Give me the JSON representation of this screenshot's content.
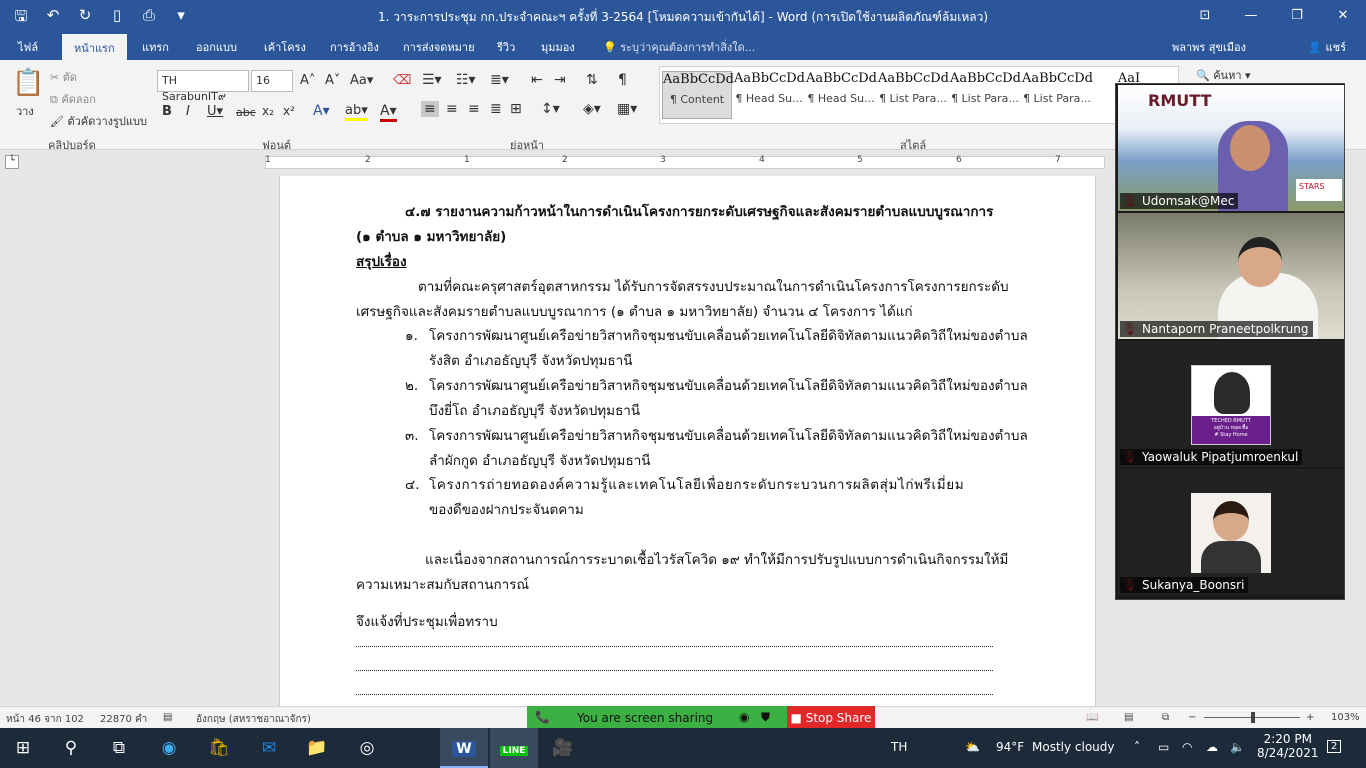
{
  "window": {
    "title": "1. วาระการประชุม กก.ประจำคณะฯ ครั้งที่ 3-2564 [โหมดความเข้ากันได้] - Word (การเปิดใช้งานผลิตภัณฑ์ล้มเหลว)"
  },
  "tabs": [
    "ไฟล์",
    "หน้าแรก",
    "แทรก",
    "ออกแบบ",
    "เค้าโครง",
    "การอ้างอิง",
    "การส่งจดหมาย",
    "รีวิว",
    "มุมมอง"
  ],
  "tell_me": "ระบุว่าคุณต้องการทำสิ่งใด...",
  "user": "พลาพร สุขเมือง",
  "share": "แชร์",
  "ribbon": {
    "paste": "วาง",
    "cut": "ตัด",
    "copy": "คัดลอก",
    "format_painter": "ตัวคัดวางรูปแบบ",
    "clipboard_label": "คลิปบอร์ด",
    "font_name": "TH SarabunIT๙",
    "font_size": "16",
    "font_label": "ฟอนต์",
    "paragraph_label": "ย่อหน้า",
    "styles_label": "สไตล์",
    "find": "ค้นหา",
    "styles": [
      {
        "preview": "AaBbCcDd",
        "name": "¶ Content"
      },
      {
        "preview": "AaBbCcDd",
        "name": "¶ Head Su..."
      },
      {
        "preview": "AaBbCcDd",
        "name": "¶ Head Su..."
      },
      {
        "preview": "AaBbCcDd",
        "name": "¶ List Para..."
      },
      {
        "preview": "AaBbCcDd",
        "name": "¶ List Para..."
      },
      {
        "preview": "AaBbCcDd",
        "name": "¶ List Para..."
      },
      {
        "preview": "AaI",
        "name": "¶"
      }
    ]
  },
  "ruler": [
    "1",
    "2",
    "1",
    "2",
    "3",
    "4",
    "5",
    "6",
    "7"
  ],
  "document": {
    "heading1": "๔.๗ รายงานความก้าวหน้าในการดำเนินโครงการยกระดับเศรษฐกิจและสังคมรายตำบลแบบบูรณาการ",
    "heading2": "(๑ ตำบล ๑ มหาวิทยาลัย)",
    "section": "สรุปเรื่อง",
    "para1a": "ตามที่คณะครุศาสตร์อุตสาหกรรม ได้รับการจัดสรรงบประมาณในการดำเนินโครงการโครงการยกระดับ",
    "para1b": "เศรษฐกิจและสังคมรายตำบลแบบบูรณาการ (๑ ตำบล  ๑ มหาวิทยาลัย) จำนวน ๔ โครงการ ได้แก่",
    "items": [
      {
        "num": "๑.",
        "l1": "โครงการพัฒนาศูนย์เครือข่ายวิสาหกิจชุมชนขับเคลื่อนด้วยเทคโนโลยีดิจิทัลตามแนวคิดวิถีใหม่ของตำบล",
        "l2": "รังสิต อำเภอธัญบุรี  จังหวัดปทุมธานี"
      },
      {
        "num": "๒.",
        "l1": "โครงการพัฒนาศูนย์เครือข่ายวิสาหกิจชุมชนขับเคลื่อนด้วยเทคโนโลยีดิจิทัลตามแนวคิดวิถีใหม่ของตำบล",
        "l2": "บึงยี่โถ อำเภอธัญบุรี  จังหวัดปทุมธานี"
      },
      {
        "num": "๓.",
        "l1": "โครงการพัฒนาศูนย์เครือข่ายวิสาหกิจชุมชนขับเคลื่อนด้วยเทคโนโลยีดิจิทัลตามแนวคิดวิถีใหม่ของตำบล",
        "l2": "ลำผักกูด อำเภอธัญบุรี  จังหวัดปทุมธานี"
      },
      {
        "num": "๔.",
        "l1": "โครงการถ่ายทอดองค์ความรู้และเทคโนโลยีเพื่อยกระดับกระบวนการผลิตสุ่มไก่พรีเมี่ยม",
        "l2": "ของดีของฝากประจันตคาม"
      }
    ],
    "para2a": "และเนื่องจากสถานการณ์การระบาดเชื้อไวรัสโควิด ๑๙ ทำให้มีการปรับรูปแบบการดำเนินกิจกรรมให้มี",
    "para2b": "ความเหมาะสมกับสถานการณ์",
    "para3": "จึงแจ้งที่ประชุมเพื่อทราบ"
  },
  "zoom": {
    "participants": [
      {
        "name": "Udomsak@Mec",
        "logo": "RMUTT",
        "badge": "STARS"
      },
      {
        "name": "Nantaporn Praneetpolkrung"
      },
      {
        "name": "Yaowaluk Pipatjumroenkul",
        "card_title": "TECHED RMUTT",
        "card_sub": "อยู่บ้าน หยุดเชื้อ",
        "card_tag": "# Stay Home"
      },
      {
        "name": "Sukanya_Boonsri"
      }
    ],
    "sharing_text": "You are screen sharing",
    "stop_share": "Stop Share"
  },
  "status": {
    "page": "หน้า 46 จาก 102",
    "words": "22870 คำ",
    "language": "อังกฤษ (สหราชอาณาจักร)",
    "zoom": "103%"
  },
  "taskbar": {
    "lang": "TH",
    "temp": "94°F",
    "weather": "Mostly cloudy",
    "time": "2:20 PM",
    "date": "8/24/2021",
    "notifications": "2",
    "line_label": "LINE"
  },
  "colors": {
    "word_blue": "#2b579a",
    "share_green": "#3cb043",
    "stop_red": "#e02828"
  }
}
